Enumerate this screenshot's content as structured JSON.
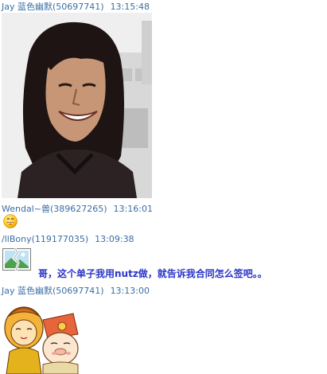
{
  "messages": [
    {
      "sender": "Jay 蓝色幽默(50697741)",
      "time": "13:15:48",
      "content_type": "photo"
    },
    {
      "sender": "Wendal~兽(389627265)",
      "time": "13:16:01",
      "content_type": "emoticon",
      "emoticon": "grin-emoticon"
    },
    {
      "sender": "/llBony(119177035)",
      "time": "13:09:38",
      "content_type": "text",
      "attachment_icon": "broken-image-icon",
      "text": "哥，这个单子我用nutz做，就告诉我合同怎么签吧。。"
    },
    {
      "sender": "Jay 蓝色幽默(50697741)",
      "time": "13:13:00",
      "content_type": "sticker"
    }
  ],
  "colors": {
    "sender": "#3a6ea5",
    "message_text": "#2a36c8"
  }
}
